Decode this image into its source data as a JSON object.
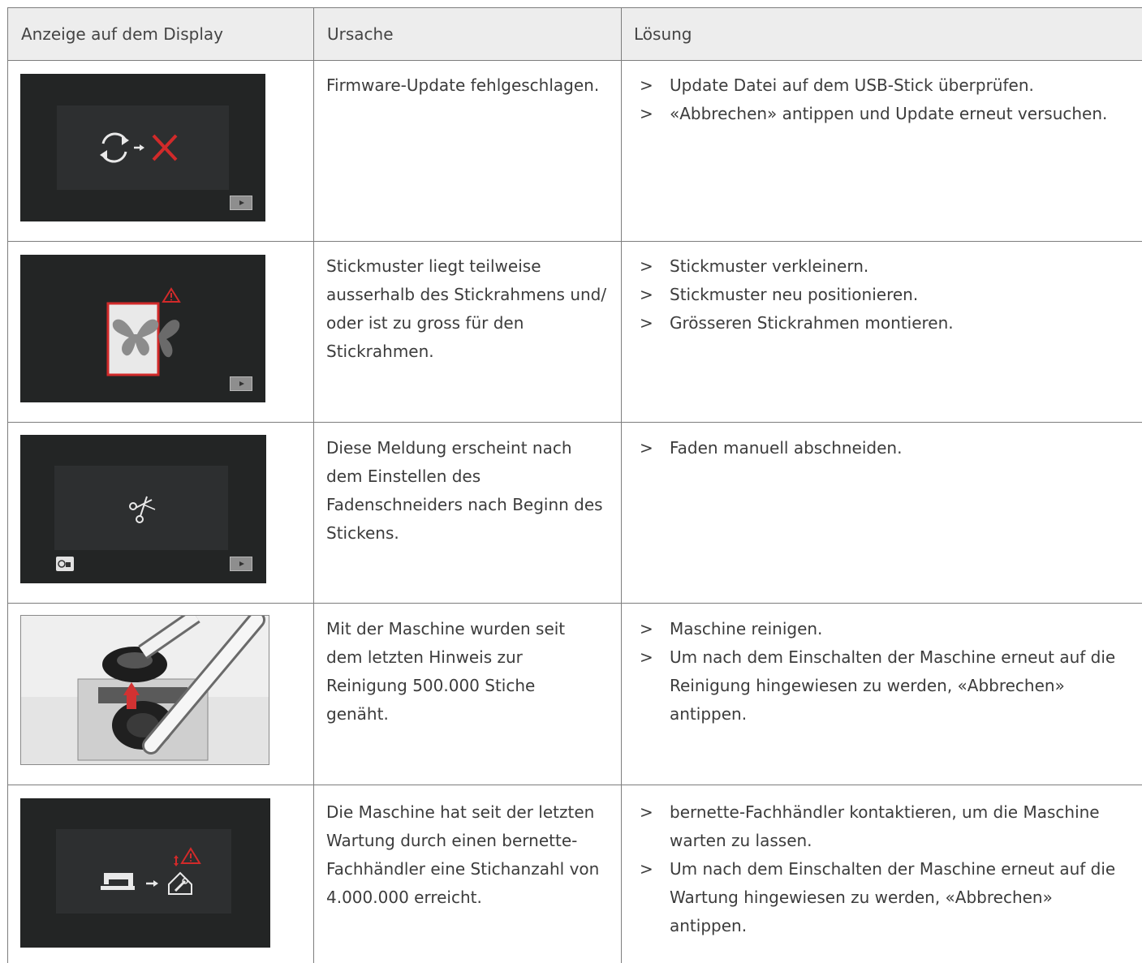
{
  "table": {
    "headers": {
      "display": "Anzeige auf dem Display",
      "cause": "Ursache",
      "solution": "Lösung"
    },
    "rows": [
      {
        "image": "firmware-update-failed-screen",
        "cause": [
          "Firmware-Update fehlgeschlagen."
        ],
        "solutions": [
          [
            "Update Datei auf dem USB-Stick überprüfen."
          ],
          [
            "«Abbrechen» antippen und Update erneut versuchen."
          ]
        ]
      },
      {
        "image": "embroidery-pattern-outside-hoop-screen",
        "cause": [
          "Stickmuster liegt teilweise",
          "ausserhalb des Stickrahmens und/",
          "oder ist zu gross für den",
          "Stickrahmen."
        ],
        "solutions": [
          [
            "Stickmuster verkleinern."
          ],
          [
            "Stickmuster neu positionieren."
          ],
          [
            "Grösseren Stickrahmen montieren."
          ]
        ]
      },
      {
        "image": "thread-cutter-screen",
        "cause": [
          "Diese Meldung erscheint nach",
          "dem Einstellen des",
          "Fadenschneiders nach Beginn des",
          "Stickens."
        ],
        "solutions": [
          [
            "Faden manuell abschneiden."
          ]
        ]
      },
      {
        "image": "machine-cleaning-photo",
        "cause": [
          "Mit der Maschine wurden seit",
          "dem letzten Hinweis zur",
          "Reinigung 500.000 Stiche",
          "genäht."
        ],
        "solutions": [
          [
            "Maschine reinigen."
          ],
          [
            "Um nach dem Einschalten der Maschine erneut auf die",
            "Reinigung hingewiesen zu werden, «Abbrechen»",
            "antippen."
          ]
        ]
      },
      {
        "image": "maintenance-required-screen",
        "cause": [
          "Die Maschine hat seit der letzten",
          "Wartung durch einen bernette-",
          "Fachhändler eine Stichanzahl von",
          "4.000.000 erreicht."
        ],
        "solutions": [
          [
            "bernette-Fachhändler kontaktieren, um die Maschine",
            "warten zu lassen."
          ],
          [
            "Um nach dem Einschalten der Maschine erneut auf die",
            "Wartung hingewiesen zu werden, «Abbrechen»",
            "antippen."
          ]
        ]
      }
    ],
    "bullet": ">"
  },
  "colors": {
    "header_bg": "#ededed",
    "border": "#7d7d7d",
    "text": "#3c3c3c",
    "screen_bg": "#232525",
    "warning_red": "#d12a2a"
  }
}
